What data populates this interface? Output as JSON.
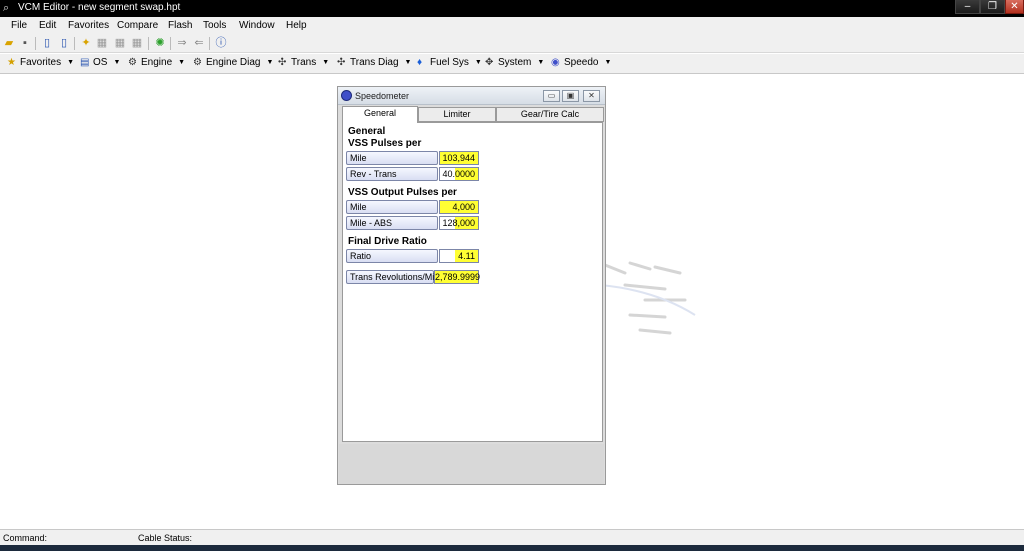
{
  "window": {
    "title": "VCM Editor - new segment swap.hpt",
    "minimize": "–",
    "maximize": "❐",
    "close": "✕"
  },
  "menu": [
    "File",
    "Edit",
    "Favorites",
    "Compare",
    "Flash",
    "Tools",
    "Window",
    "Help"
  ],
  "toolbar_icons": [
    "open-icon",
    "save-icon",
    "document-icon",
    "document-info-icon",
    "folder-star-icon",
    "table-icon",
    "table-icon",
    "table-icon",
    "spark-icon",
    "read-vehicle-icon",
    "write-vehicle-icon",
    "info-icon"
  ],
  "modules": [
    {
      "label": "Favorites",
      "icon": "star-icon",
      "glyph": "★",
      "color": "#d4a000"
    },
    {
      "label": "OS",
      "icon": "os-icon",
      "glyph": "▤",
      "color": "#2a55b0"
    },
    {
      "label": "Engine",
      "icon": "engine-icon",
      "glyph": "⚙",
      "color": "#333"
    },
    {
      "label": "Engine Diag",
      "icon": "engine-diag-icon",
      "glyph": "⚙",
      "color": "#333"
    },
    {
      "label": "Trans",
      "icon": "trans-icon",
      "glyph": "✣",
      "color": "#333"
    },
    {
      "label": "Trans Diag",
      "icon": "trans-diag-icon",
      "glyph": "✣",
      "color": "#333"
    },
    {
      "label": "Fuel Sys",
      "icon": "fuel-drop-icon",
      "glyph": "💧",
      "color": "#1a5fd8"
    },
    {
      "label": "System",
      "icon": "system-icon",
      "glyph": "✥",
      "color": "#333"
    },
    {
      "label": "Speedo",
      "icon": "speedo-icon",
      "glyph": "◉",
      "color": "#3f4fc9"
    }
  ],
  "dropdown_glyph": "▼",
  "speedometer": {
    "title": "Speedometer",
    "tabs": [
      "General",
      "Limiter",
      "Gear/Tire Calc"
    ],
    "active_tab": "General",
    "sections": {
      "general": "General",
      "vss_pulses": "VSS Pulses per",
      "vss_output": "VSS Output Pulses per",
      "final_drive": "Final Drive Ratio"
    },
    "fields": {
      "pulses_mile": {
        "label": "Mile",
        "value": "103,944"
      },
      "pulses_rev_trans": {
        "label": "Rev - Trans",
        "value": "40.0000"
      },
      "output_mile": {
        "label": "Mile",
        "value": "4,000"
      },
      "output_mile_abs": {
        "label": "Mile - ABS",
        "value": "128,000"
      },
      "ratio": {
        "label": "Ratio",
        "value": "4.11"
      },
      "trans_rev_mile": {
        "label": "Trans Revolutions/Mile",
        "value": "2,789.9999"
      }
    }
  },
  "status": {
    "command_label": "Command:",
    "cable_label": "Cable Status:"
  }
}
